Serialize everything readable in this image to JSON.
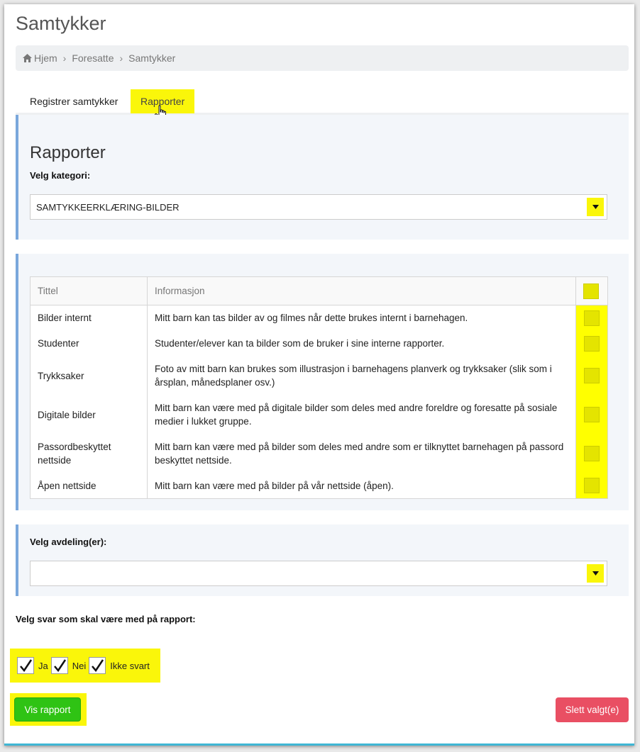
{
  "page": {
    "title": "Samtykker"
  },
  "breadcrumb": {
    "items": [
      "Hjem",
      "Foresatte",
      "Samtykker"
    ]
  },
  "tabs": [
    {
      "label": "Registrer samtykker",
      "active": false
    },
    {
      "label": "Rapporter",
      "active": true
    }
  ],
  "rapporter": {
    "heading": "Rapporter",
    "category_label": "Velg kategori:",
    "category_value": "SAMTYKKEERKLÆRING-BILDER"
  },
  "table": {
    "headers": [
      "Tittel",
      "Informasjon"
    ],
    "rows": [
      {
        "title": "Bilder internt",
        "info": "Mitt barn kan tas bilder av og filmes når dette brukes internt i barnehagen."
      },
      {
        "title": "Studenter",
        "info": "Studenter/elever kan ta bilder som de bruker i sine interne rapporter."
      },
      {
        "title": "Trykksaker",
        "info": "Foto av mitt barn kan brukes som illustrasjon i barnehagens planverk og trykksaker (slik som i årsplan, månedsplaner osv.)"
      },
      {
        "title": "Digitale bilder",
        "info": "Mitt barn kan være med på digitale bilder som deles med andre foreldre og foresatte på sosiale medier i lukket gruppe."
      },
      {
        "title": "Passordbeskyttet nettside",
        "info": "Mitt barn kan være med på bilder som deles med andre som er tilknyttet barnehagen på passord beskyttet nettside."
      },
      {
        "title": "Åpen nettside",
        "info": "Mitt barn kan være med på bilder på vår nettside (åpen)."
      }
    ]
  },
  "avdeling": {
    "label": "Velg avdeling(er):",
    "value": ""
  },
  "svar": {
    "label": "Velg svar som skal være med på rapport:",
    "options": [
      {
        "label": "Ja",
        "checked": true
      },
      {
        "label": "Nei",
        "checked": true
      },
      {
        "label": "Ikke svart",
        "checked": true
      }
    ]
  },
  "buttons": {
    "vis": "Vis rapport",
    "slett": "Slett valgt(e)"
  },
  "colors": {
    "highlight": "#faf60a",
    "accent_border": "#7aa7dc",
    "vis_green": "#2fc314",
    "slett_red": "#e94f63"
  },
  "icons": {
    "home": "home-icon",
    "cursor": "hand-cursor-icon",
    "dropdown": "caret-down-icon",
    "check": "checkmark-icon"
  }
}
